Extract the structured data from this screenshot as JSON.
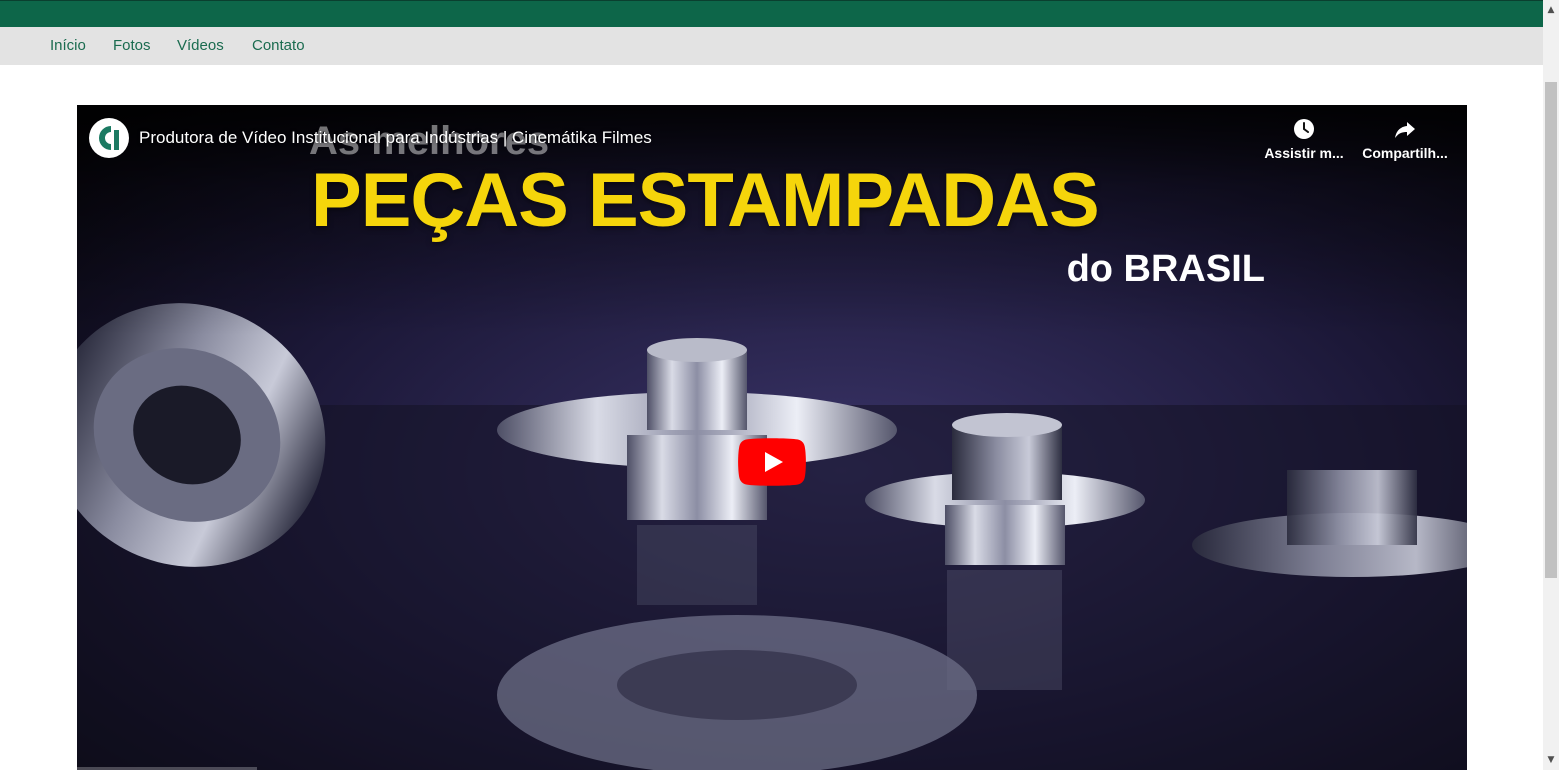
{
  "nav": {
    "items": [
      {
        "label": "Início"
      },
      {
        "label": "Fotos"
      },
      {
        "label": "Vídeos"
      },
      {
        "label": "Contato"
      }
    ]
  },
  "video": {
    "title": "Produtora de Vídeo Institucional para Indústrias | Cinemátika Filmes",
    "channel_logo": "cinematika-logo",
    "actions": {
      "watch_later": {
        "label": "Assistir m...",
        "icon": "clock-icon"
      },
      "share": {
        "label": "Compartilh...",
        "icon": "share-icon"
      }
    },
    "overlay": {
      "line1": "As melhores",
      "line2": "PEÇAS ESTAMPADAS",
      "line3": "do BRASIL"
    },
    "play_icon": "play-icon"
  },
  "colors": {
    "topbar": "#0d6649",
    "navbar": "#e3e3e3",
    "nav_text": "#1a6b4f",
    "headline_yellow": "#f5d50b",
    "play_red": "#ff0000"
  }
}
